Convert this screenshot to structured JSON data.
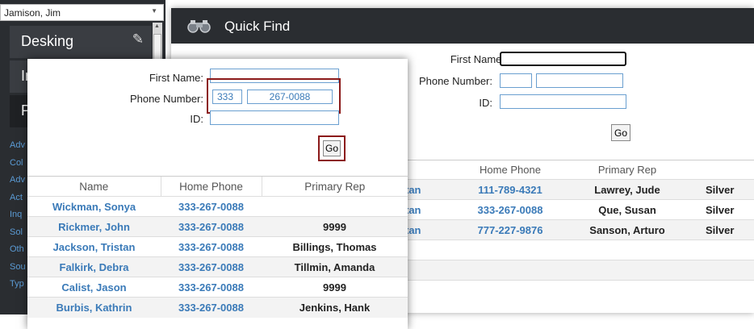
{
  "sidebar": {
    "user": "Jamison, Jim",
    "items": [
      {
        "label": "Desking"
      },
      {
        "label": "In"
      },
      {
        "label": "P"
      }
    ],
    "links": [
      "Adv",
      "Col",
      "Adv",
      "Act",
      "Inq",
      "Sol",
      "Oth",
      "Sou",
      "Typ"
    ]
  },
  "background_window": {
    "title": "Quick Find",
    "form": {
      "first_name_label": "First Name:",
      "phone_label": "Phone Number:",
      "id_label": "ID:",
      "go_label": "Go"
    },
    "columns": [
      "",
      "Home Phone",
      "Primary Rep",
      ""
    ],
    "rows": [
      {
        "name": "tan",
        "phone": "111-789-4321",
        "rep": "Lawrey, Jude",
        "extra": "Silver"
      },
      {
        "name": "tan",
        "phone": "333-267-0088",
        "rep": "Que, Susan",
        "extra": "Silver"
      },
      {
        "name": "tan",
        "phone": "777-227-9876",
        "rep": "Sanson, Arturo",
        "extra": "Silver"
      }
    ]
  },
  "popup": {
    "form": {
      "first_name_label": "First Name:",
      "phone_label": "Phone Number:",
      "area_code": "333",
      "phone_number": "267-0088",
      "id_label": "ID:",
      "go_label": "Go"
    },
    "columns": [
      "Name",
      "Home Phone",
      "Primary Rep"
    ],
    "rows": [
      {
        "name": "Wickman, Sonya",
        "phone": "333-267-0088",
        "rep": ""
      },
      {
        "name": "Rickmer, John",
        "phone": "333-267-0088",
        "rep": "9999"
      },
      {
        "name": "Jackson, Tristan",
        "phone": "333-267-0088",
        "rep": "Billings, Thomas"
      },
      {
        "name": "Falkirk, Debra",
        "phone": "333-267-0088",
        "rep": "Tillmin, Amanda"
      },
      {
        "name": "Calist, Jason",
        "phone": "333-267-0088",
        "rep": "9999"
      },
      {
        "name": "Burbis, Kathrin",
        "phone": "333-267-0088",
        "rep": "Jenkins, Hank"
      }
    ]
  },
  "colors": {
    "sidebar_bg": "#2a2d31",
    "link": "#3a7ab8",
    "input_border": "#6a9fd0",
    "highlight": "#8b1a1a"
  }
}
